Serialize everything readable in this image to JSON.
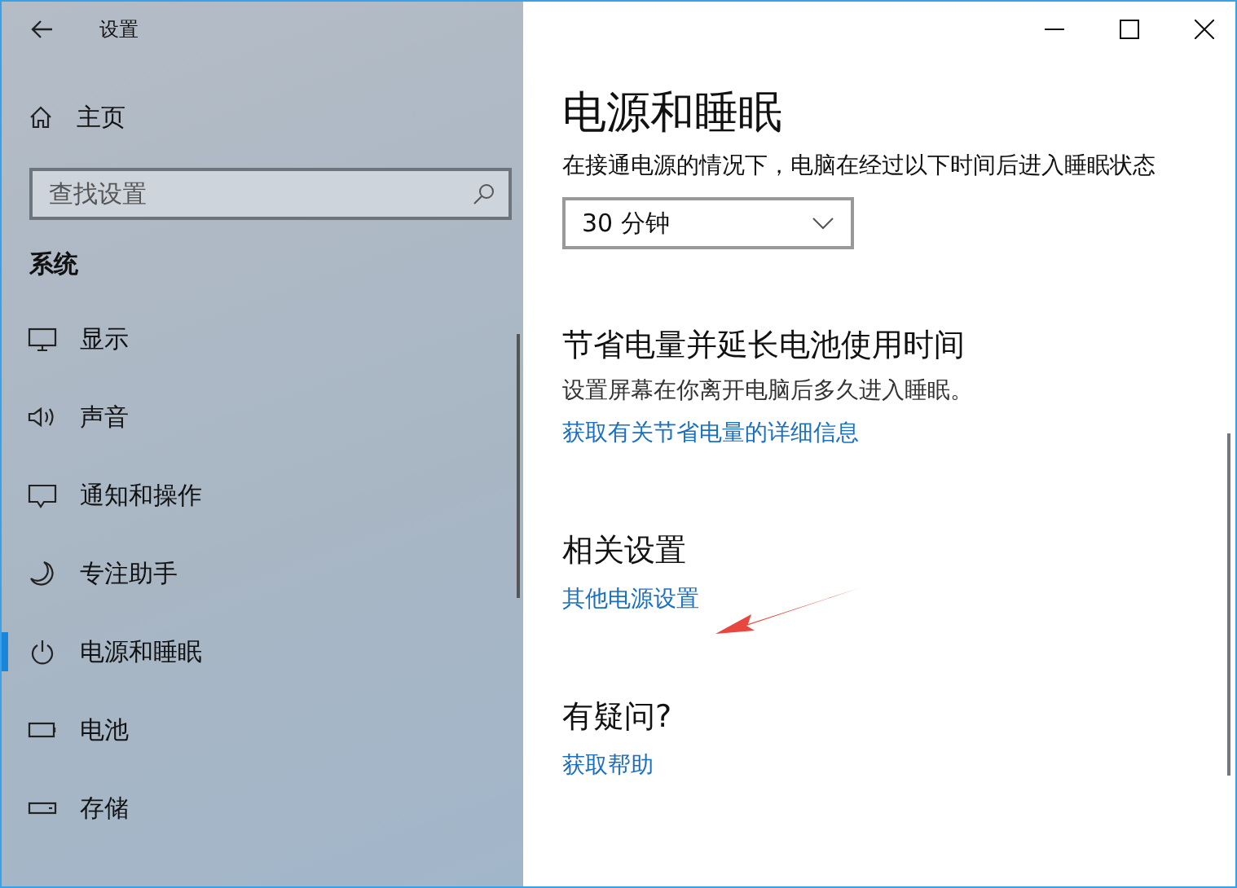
{
  "window": {
    "title": "设置"
  },
  "sidebar": {
    "home": "主页",
    "search": {
      "placeholder": "查找设置"
    },
    "section": "系统",
    "items": [
      {
        "label": "显示",
        "selected": false
      },
      {
        "label": "声音",
        "selected": false
      },
      {
        "label": "通知和操作",
        "selected": false
      },
      {
        "label": "专注助手",
        "selected": false
      },
      {
        "label": "电源和睡眠",
        "selected": true
      },
      {
        "label": "电池",
        "selected": false
      },
      {
        "label": "存储",
        "selected": false
      }
    ]
  },
  "main": {
    "title": "电源和睡眠",
    "description": "在接通电源的情况下，电脑在经过以下时间后进入睡眠状态",
    "sleep_dropdown": {
      "value": "30 分钟"
    },
    "sections": [
      {
        "heading": "节省电量并延长电池使用时间",
        "text": "设置屏幕在你离开电脑后多久进入睡眠。",
        "link": "获取有关节省电量的详细信息"
      },
      {
        "heading": "相关设置",
        "link": "其他电源设置"
      },
      {
        "heading": "有疑问?",
        "link": "获取帮助"
      }
    ]
  }
}
